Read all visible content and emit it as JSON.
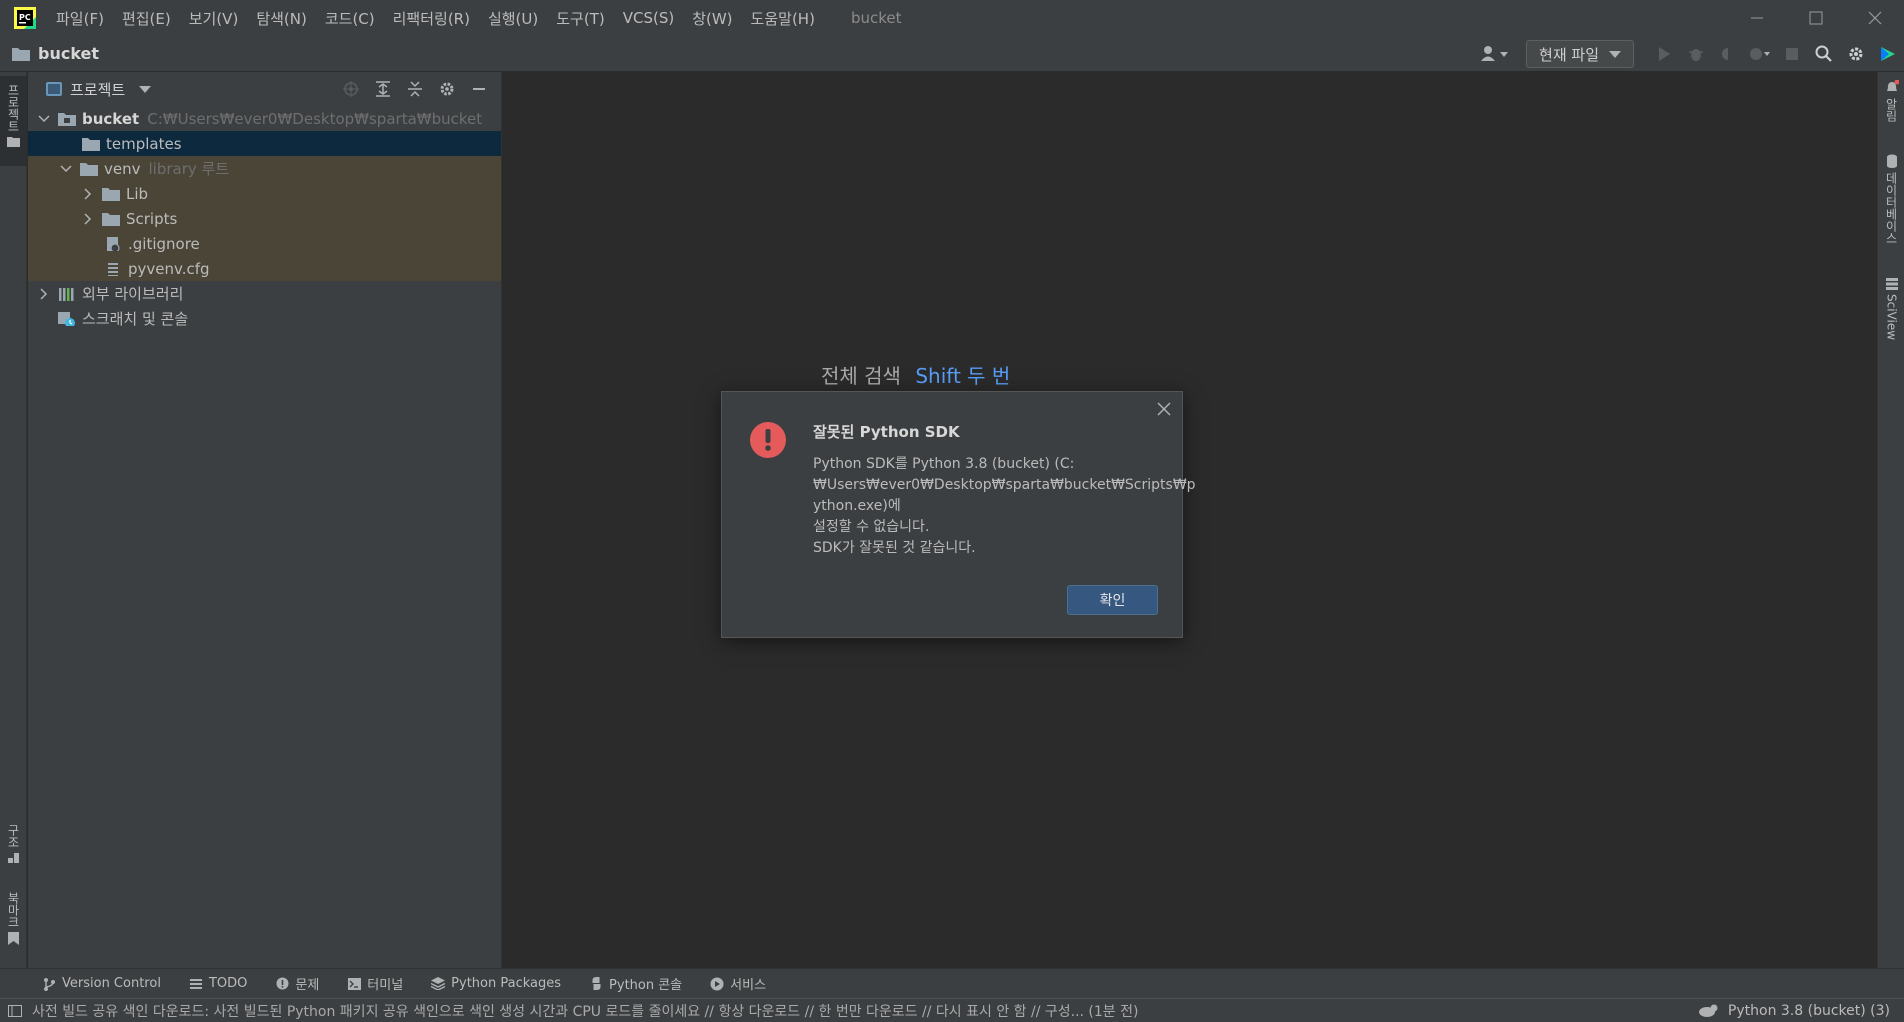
{
  "window": {
    "title": "bucket",
    "menu": [
      "파일(F)",
      "편집(E)",
      "보기(V)",
      "탐색(N)",
      "코드(C)",
      "리팩터링(R)",
      "실행(U)",
      "도구(T)",
      "VCS(S)",
      "창(W)",
      "도움말(H)"
    ]
  },
  "navbar": {
    "breadcrumb": "bucket",
    "run_config": "현재 파일"
  },
  "left_stripe": {
    "project_tab": "프로젝트",
    "structure_tab": "구조",
    "bookmarks_tab": "북마크"
  },
  "right_stripe": {
    "notifications_tab": "알림",
    "database_tab": "데이터베이스",
    "sciview_tab": "SciView"
  },
  "project_panel": {
    "title": "프로젝트",
    "tree": {
      "root_name": "bucket",
      "root_path": "C:₩Users₩ever0₩Desktop₩sparta₩bucket",
      "templates": "templates",
      "venv": "venv",
      "venv_hint": "library 루트",
      "lib": "Lib",
      "scripts": "Scripts",
      "gitignore": ".gitignore",
      "pyvenv": "pyvenv.cfg",
      "external_libs": "외부 라이브러리",
      "scratches": "스크래치 및 콘솔"
    }
  },
  "editor": {
    "search_hint": "전체 검색",
    "search_key": "Shift 두 번"
  },
  "dialog": {
    "title": "잘못된 Python SDK",
    "lines": [
      "Python SDK를 Python 3.8 (bucket) (C:",
      "₩Users₩ever0₩Desktop₩sparta₩bucket₩Scripts₩p",
      "ython.exe)에",
      "설정할 수 없습니다.",
      "SDK가 잘못된 것 같습니다."
    ],
    "ok_label": "확인"
  },
  "bottom_tools": [
    {
      "label": "Version Control",
      "icon": "branch-icon"
    },
    {
      "label": "TODO",
      "icon": "list-icon"
    },
    {
      "label": "문제",
      "icon": "problems-icon"
    },
    {
      "label": "터미널",
      "icon": "terminal-icon"
    },
    {
      "label": "Python Packages",
      "icon": "layers-icon"
    },
    {
      "label": "Python 콘솔",
      "icon": "python-icon"
    },
    {
      "label": "서비스",
      "icon": "services-icon"
    }
  ],
  "status": {
    "message": "사전 빌드 공유 색인 다운로드: 사전 빌드된 Python 패키지 공유 색인으로 색인 생성 시간과 CPU 로드를 줄이세요 // 항상 다운로드 // 한 번만 다운로드 // 다시 표시 안 함 // 구성... (1분 전)",
    "interpreter": "Python 3.8 (bucket) (3)"
  },
  "colors": {
    "accent": "#589df6",
    "error": "#e55b5b",
    "selection": "#0d293e",
    "excluded": "#4b4538",
    "button": "#365880"
  }
}
